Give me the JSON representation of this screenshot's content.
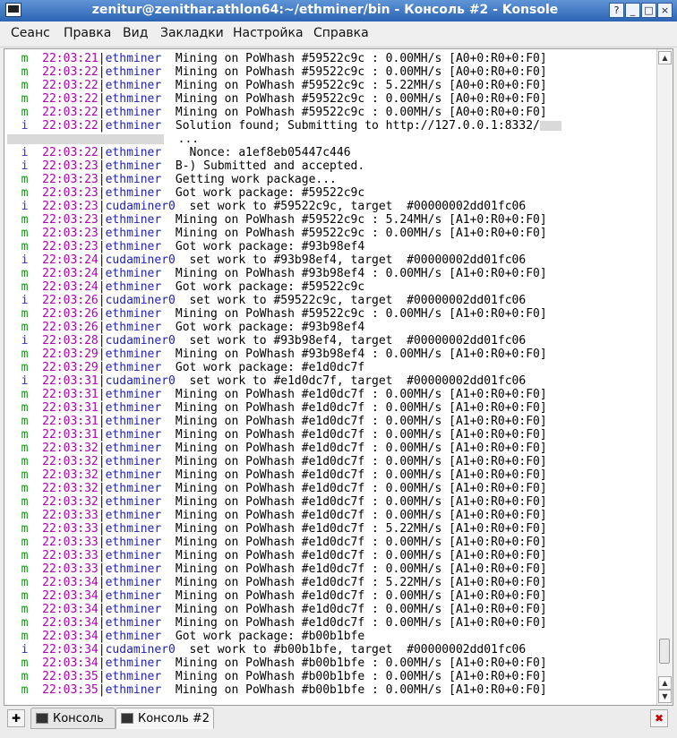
{
  "window": {
    "title": "zenitur@zenithar.athlon64:~/ethminer/bin - Консоль #2 - Konsole",
    "controls": {
      "help": "?",
      "minimize": "_",
      "maximize": "□",
      "close": "×"
    }
  },
  "menu": [
    "Сеанс",
    "Правка",
    "Вид",
    "Закладки",
    "Настройка",
    "Справка"
  ],
  "log": [
    {
      "lvl": "m",
      "ts": "22:03:21",
      "src": "ethminer ",
      "msg": " Mining on PoWhash #59522c9c : 0.00MH/s [A0+0:R0+0:F0]"
    },
    {
      "lvl": "m",
      "ts": "22:03:22",
      "src": "ethminer ",
      "msg": " Mining on PoWhash #59522c9c : 0.00MH/s [A0+0:R0+0:F0]"
    },
    {
      "lvl": "m",
      "ts": "22:03:22",
      "src": "ethminer ",
      "msg": " Mining on PoWhash #59522c9c : 5.22MH/s [A0+0:R0+0:F0]"
    },
    {
      "lvl": "m",
      "ts": "22:03:22",
      "src": "ethminer ",
      "msg": " Mining on PoWhash #59522c9c : 0.00MH/s [A0+0:R0+0:F0]"
    },
    {
      "lvl": "m",
      "ts": "22:03:22",
      "src": "ethminer ",
      "msg": " Mining on PoWhash #59522c9c : 0.00MH/s [A0+0:R0+0:F0]"
    },
    {
      "lvl": "i",
      "ts": "22:03:22",
      "src": "ethminer ",
      "msg": " Solution found; Submitting to http://127.0.0.1:8332/"
    },
    {
      "lvl": "",
      "ts": "",
      "src": "",
      "msg": "...",
      "wrap": true
    },
    {
      "lvl": "i",
      "ts": "22:03:22",
      "src": "ethminer ",
      "msg": "   Nonce: a1ef8eb05447c446"
    },
    {
      "lvl": "i",
      "ts": "22:03:23",
      "src": "ethminer ",
      "msg": " B-) Submitted and accepted."
    },
    {
      "lvl": "m",
      "ts": "22:03:23",
      "src": "ethminer ",
      "msg": " Getting work package..."
    },
    {
      "lvl": "m",
      "ts": "22:03:23",
      "src": "ethminer ",
      "msg": " Got work package: #59522c9c"
    },
    {
      "lvl": "i",
      "ts": "22:03:23",
      "src": "cudaminer0",
      "msg": "  set work to #59522c9c, target  #00000002dd01fc06"
    },
    {
      "lvl": "m",
      "ts": "22:03:23",
      "src": "ethminer ",
      "msg": " Mining on PoWhash #59522c9c : 5.24MH/s [A1+0:R0+0:F0]"
    },
    {
      "lvl": "m",
      "ts": "22:03:23",
      "src": "ethminer ",
      "msg": " Mining on PoWhash #59522c9c : 0.00MH/s [A1+0:R0+0:F0]"
    },
    {
      "lvl": "m",
      "ts": "22:03:23",
      "src": "ethminer ",
      "msg": " Got work package: #93b98ef4"
    },
    {
      "lvl": "i",
      "ts": "22:03:24",
      "src": "cudaminer0",
      "msg": "  set work to #93b98ef4, target  #00000002dd01fc06"
    },
    {
      "lvl": "m",
      "ts": "22:03:24",
      "src": "ethminer ",
      "msg": " Mining on PoWhash #93b98ef4 : 0.00MH/s [A1+0:R0+0:F0]"
    },
    {
      "lvl": "m",
      "ts": "22:03:24",
      "src": "ethminer ",
      "msg": " Got work package: #59522c9c"
    },
    {
      "lvl": "i",
      "ts": "22:03:26",
      "src": "cudaminer0",
      "msg": "  set work to #59522c9c, target  #00000002dd01fc06"
    },
    {
      "lvl": "m",
      "ts": "22:03:26",
      "src": "ethminer ",
      "msg": " Mining on PoWhash #59522c9c : 0.00MH/s [A1+0:R0+0:F0]"
    },
    {
      "lvl": "m",
      "ts": "22:03:26",
      "src": "ethminer ",
      "msg": " Got work package: #93b98ef4"
    },
    {
      "lvl": "i",
      "ts": "22:03:28",
      "src": "cudaminer0",
      "msg": "  set work to #93b98ef4, target  #00000002dd01fc06"
    },
    {
      "lvl": "m",
      "ts": "22:03:29",
      "src": "ethminer ",
      "msg": " Mining on PoWhash #93b98ef4 : 0.00MH/s [A1+0:R0+0:F0]"
    },
    {
      "lvl": "m",
      "ts": "22:03:29",
      "src": "ethminer ",
      "msg": " Got work package: #e1d0dc7f"
    },
    {
      "lvl": "i",
      "ts": "22:03:31",
      "src": "cudaminer0",
      "msg": "  set work to #e1d0dc7f, target  #00000002dd01fc06"
    },
    {
      "lvl": "m",
      "ts": "22:03:31",
      "src": "ethminer ",
      "msg": " Mining on PoWhash #e1d0dc7f : 0.00MH/s [A1+0:R0+0:F0]"
    },
    {
      "lvl": "m",
      "ts": "22:03:31",
      "src": "ethminer ",
      "msg": " Mining on PoWhash #e1d0dc7f : 0.00MH/s [A1+0:R0+0:F0]"
    },
    {
      "lvl": "m",
      "ts": "22:03:31",
      "src": "ethminer ",
      "msg": " Mining on PoWhash #e1d0dc7f : 0.00MH/s [A1+0:R0+0:F0]"
    },
    {
      "lvl": "m",
      "ts": "22:03:31",
      "src": "ethminer ",
      "msg": " Mining on PoWhash #e1d0dc7f : 0.00MH/s [A1+0:R0+0:F0]"
    },
    {
      "lvl": "m",
      "ts": "22:03:32",
      "src": "ethminer ",
      "msg": " Mining on PoWhash #e1d0dc7f : 0.00MH/s [A1+0:R0+0:F0]"
    },
    {
      "lvl": "m",
      "ts": "22:03:32",
      "src": "ethminer ",
      "msg": " Mining on PoWhash #e1d0dc7f : 0.00MH/s [A1+0:R0+0:F0]"
    },
    {
      "lvl": "m",
      "ts": "22:03:32",
      "src": "ethminer ",
      "msg": " Mining on PoWhash #e1d0dc7f : 0.00MH/s [A1+0:R0+0:F0]"
    },
    {
      "lvl": "m",
      "ts": "22:03:32",
      "src": "ethminer ",
      "msg": " Mining on PoWhash #e1d0dc7f : 0.00MH/s [A1+0:R0+0:F0]"
    },
    {
      "lvl": "m",
      "ts": "22:03:32",
      "src": "ethminer ",
      "msg": " Mining on PoWhash #e1d0dc7f : 0.00MH/s [A1+0:R0+0:F0]"
    },
    {
      "lvl": "m",
      "ts": "22:03:33",
      "src": "ethminer ",
      "msg": " Mining on PoWhash #e1d0dc7f : 0.00MH/s [A1+0:R0+0:F0]"
    },
    {
      "lvl": "m",
      "ts": "22:03:33",
      "src": "ethminer ",
      "msg": " Mining on PoWhash #e1d0dc7f : 5.22MH/s [A1+0:R0+0:F0]"
    },
    {
      "lvl": "m",
      "ts": "22:03:33",
      "src": "ethminer ",
      "msg": " Mining on PoWhash #e1d0dc7f : 0.00MH/s [A1+0:R0+0:F0]"
    },
    {
      "lvl": "m",
      "ts": "22:03:33",
      "src": "ethminer ",
      "msg": " Mining on PoWhash #e1d0dc7f : 0.00MH/s [A1+0:R0+0:F0]"
    },
    {
      "lvl": "m",
      "ts": "22:03:33",
      "src": "ethminer ",
      "msg": " Mining on PoWhash #e1d0dc7f : 0.00MH/s [A1+0:R0+0:F0]"
    },
    {
      "lvl": "m",
      "ts": "22:03:34",
      "src": "ethminer ",
      "msg": " Mining on PoWhash #e1d0dc7f : 5.22MH/s [A1+0:R0+0:F0]"
    },
    {
      "lvl": "m",
      "ts": "22:03:34",
      "src": "ethminer ",
      "msg": " Mining on PoWhash #e1d0dc7f : 0.00MH/s [A1+0:R0+0:F0]"
    },
    {
      "lvl": "m",
      "ts": "22:03:34",
      "src": "ethminer ",
      "msg": " Mining on PoWhash #e1d0dc7f : 0.00MH/s [A1+0:R0+0:F0]"
    },
    {
      "lvl": "m",
      "ts": "22:03:34",
      "src": "ethminer ",
      "msg": " Mining on PoWhash #e1d0dc7f : 0.00MH/s [A1+0:R0+0:F0]"
    },
    {
      "lvl": "m",
      "ts": "22:03:34",
      "src": "ethminer ",
      "msg": " Got work package: #b00b1bfe"
    },
    {
      "lvl": "i",
      "ts": "22:03:34",
      "src": "cudaminer0",
      "msg": "  set work to #b00b1bfe, target  #00000002dd01fc06"
    },
    {
      "lvl": "m",
      "ts": "22:03:34",
      "src": "ethminer ",
      "msg": " Mining on PoWhash #b00b1bfe : 0.00MH/s [A1+0:R0+0:F0]"
    },
    {
      "lvl": "m",
      "ts": "22:03:35",
      "src": "ethminer ",
      "msg": " Mining on PoWhash #b00b1bfe : 0.00MH/s [A1+0:R0+0:F0]"
    },
    {
      "lvl": "m",
      "ts": "22:03:35",
      "src": "ethminer ",
      "msg": " Mining on PoWhash #b00b1bfe : 0.00MH/s [A1+0:R0+0:F0]"
    }
  ],
  "tabs": [
    {
      "label": "Консоль",
      "active": false
    },
    {
      "label": "Консоль #2",
      "active": true
    }
  ],
  "icons": {
    "new_tab": "new-session-icon",
    "close_tab": "close-session-icon"
  }
}
